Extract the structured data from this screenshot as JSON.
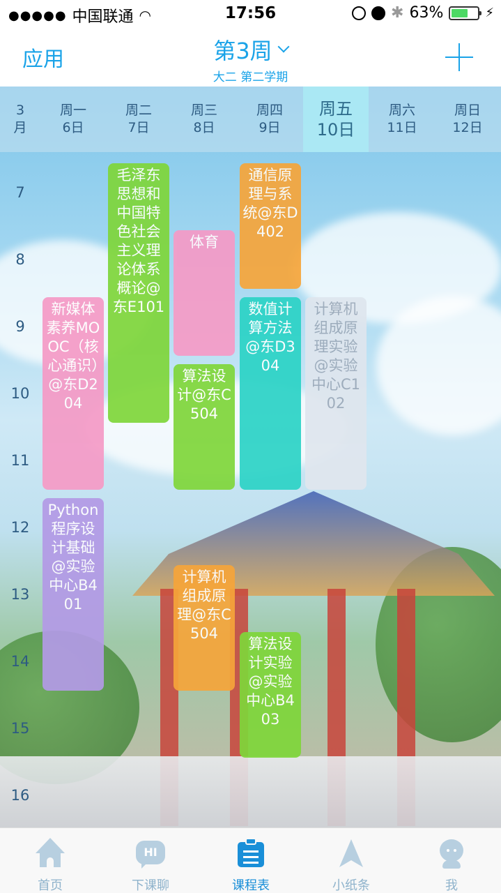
{
  "status_bar": {
    "carrier": "中国联通",
    "time": "17:56",
    "battery": "63%",
    "battery_level": 0.63
  },
  "nav": {
    "left_label": "应用",
    "week_label": "第3周",
    "term_label": "大二 第二学期"
  },
  "header": {
    "month_num": "3",
    "month_unit": "月",
    "days": [
      {
        "weekday": "周一",
        "date": "6日"
      },
      {
        "weekday": "周二",
        "date": "7日"
      },
      {
        "weekday": "周三",
        "date": "8日"
      },
      {
        "weekday": "周四",
        "date": "9日"
      },
      {
        "weekday": "周五",
        "date": "10日"
      },
      {
        "weekday": "周六",
        "date": "11日"
      },
      {
        "weekday": "周日",
        "date": "12日"
      }
    ]
  },
  "hours": [
    "7",
    "8",
    "9",
    "10",
    "11",
    "12",
    "13",
    "14",
    "15",
    "16"
  ],
  "courses": [
    {
      "text": "毛泽东思想和中国特色社会主义理论体系概论@东E101",
      "color": "#7fd63a"
    },
    {
      "text": "通信原理与系统@东D402",
      "color": "#f6a53a"
    },
    {
      "text": "体育",
      "color": "#f59ac6"
    },
    {
      "text": "新媒体素养MOOC（核心通识）@东D204",
      "color": "#f59ac6"
    },
    {
      "text": "数值计算方法@东D304",
      "color": "#2bd3c6"
    },
    {
      "text": "计算机组成原理实验@实验中心C102",
      "color": "#dfe6ee"
    },
    {
      "text": "算法设计@东C504",
      "color": "#7fd63a"
    },
    {
      "text": "Python程序设计基础@实验中心B401",
      "color": "#b39ae6"
    },
    {
      "text": "计算机组成原理@东C504",
      "color": "#f6a53a"
    },
    {
      "text": "算法设计实验@实验中心B403",
      "color": "#7fd63a"
    }
  ],
  "tabs": [
    {
      "label": "首页",
      "icon": "home-icon"
    },
    {
      "label": "下课聊",
      "icon": "chat-icon"
    },
    {
      "label": "课程表",
      "icon": "schedule-icon"
    },
    {
      "label": "小纸条",
      "icon": "paper-plane-icon"
    },
    {
      "label": "我",
      "icon": "profile-icon"
    }
  ],
  "chat_icon_text": "HI"
}
